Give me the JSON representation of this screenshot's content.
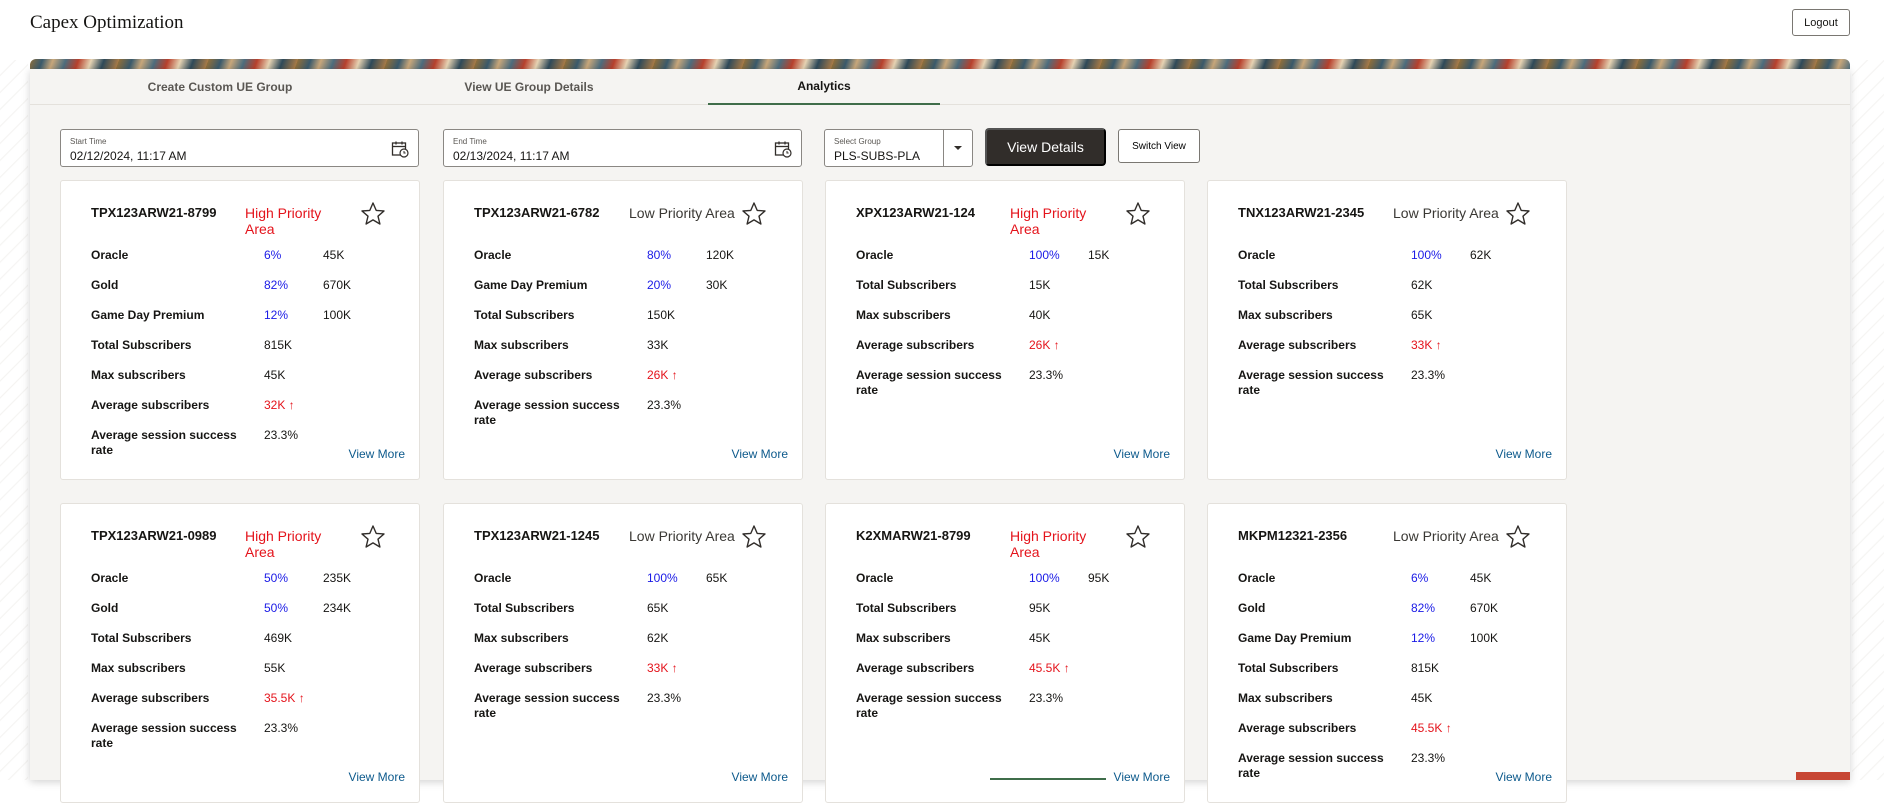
{
  "app": {
    "title": "Capex Optimization",
    "logout_label": "Logout"
  },
  "tabs": [
    {
      "label": "Create Custom UE Group"
    },
    {
      "label": "View UE Group Details"
    },
    {
      "label": "Analytics"
    }
  ],
  "filters": {
    "start_time": {
      "label": "Start Time",
      "value": "02/12/2024, 11:17 AM"
    },
    "end_time": {
      "label": "End Time",
      "value": "02/13/2024, 11:17 AM"
    },
    "group": {
      "label": "Select Group",
      "value": "PLS-SUBS-PLA"
    },
    "view_details_label": "View Details",
    "switch_view_label": "Switch View"
  },
  "colors": {
    "accent_dark": "#312d2a",
    "high_priority": "#e4131b",
    "percent": "#1a1ae6",
    "link": "#0d5a8c",
    "tab_underline": "#3f6d4a"
  },
  "cards": [
    {
      "id": "TPX123ARW21-8799",
      "priority": "High Priority Area",
      "level": "high",
      "rows": [
        {
          "label": "Oracle",
          "v1": "6%",
          "v2": "45K",
          "s1": "blue"
        },
        {
          "label": "Gold",
          "v1": "82%",
          "v2": "670K",
          "s1": "blue"
        },
        {
          "label": "Game Day Premium",
          "v1": "12%",
          "v2": "100K",
          "s1": "blue"
        },
        {
          "label": "Total Subscribers",
          "v1": "815K",
          "v2": ""
        },
        {
          "label": "Max subscribers",
          "v1": "45K",
          "v2": ""
        },
        {
          "label": "Average subscribers",
          "v1": "32K ↑",
          "v2": "",
          "s1": "red"
        },
        {
          "label": "Average session success rate",
          "v1": "23.3%",
          "v2": ""
        }
      ],
      "view_more": "View More"
    },
    {
      "id": "TPX123ARW21-6782",
      "priority": "Low Priority Area",
      "level": "low",
      "rows": [
        {
          "label": "Oracle",
          "v1": "80%",
          "v2": "120K",
          "s1": "blue"
        },
        {
          "label": "Game Day Premium",
          "v1": "20%",
          "v2": "30K",
          "s1": "blue"
        },
        {
          "label": "Total Subscribers",
          "v1": "150K",
          "v2": ""
        },
        {
          "label": "Max subscribers",
          "v1": "33K",
          "v2": ""
        },
        {
          "label": "Average subscribers",
          "v1": "26K ↑",
          "v2": "",
          "s1": "red"
        },
        {
          "label": "Average session success rate",
          "v1": "23.3%",
          "v2": ""
        }
      ],
      "view_more": "View More"
    },
    {
      "id": "XPX123ARW21-124",
      "priority": "High Priority Area",
      "level": "high",
      "rows": [
        {
          "label": "Oracle",
          "v1": "100%",
          "v2": "15K",
          "s1": "blue"
        },
        {
          "label": "Total Subscribers",
          "v1": "15K",
          "v2": ""
        },
        {
          "label": "Max subscribers",
          "v1": "40K",
          "v2": ""
        },
        {
          "label": "Average subscribers",
          "v1": "26K ↑",
          "v2": "",
          "s1": "red"
        },
        {
          "label": "Average session success rate",
          "v1": "23.3%",
          "v2": ""
        }
      ],
      "view_more": "View More"
    },
    {
      "id": "TNX123ARW21-2345",
      "priority": "Low Priority Area",
      "level": "low",
      "rows": [
        {
          "label": "Oracle",
          "v1": "100%",
          "v2": "62K",
          "s1": "blue"
        },
        {
          "label": "Total Subscribers",
          "v1": "62K",
          "v2": ""
        },
        {
          "label": "Max subscribers",
          "v1": "65K",
          "v2": ""
        },
        {
          "label": "Average subscribers",
          "v1": "33K ↑",
          "v2": "",
          "s1": "red"
        },
        {
          "label": "Average session success rate",
          "v1": "23.3%",
          "v2": ""
        }
      ],
      "view_more": "View More"
    },
    {
      "id": "TPX123ARW21-0989",
      "priority": "High Priority Area",
      "level": "high",
      "rows": [
        {
          "label": "Oracle",
          "v1": "50%",
          "v2": "235K",
          "s1": "blue"
        },
        {
          "label": "Gold",
          "v1": "50%",
          "v2": "234K",
          "s1": "blue"
        },
        {
          "label": "Total Subscribers",
          "v1": "469K",
          "v2": ""
        },
        {
          "label": "Max subscribers",
          "v1": "55K",
          "v2": ""
        },
        {
          "label": "Average subscribers",
          "v1": "35.5K ↑",
          "v2": "",
          "s1": "red"
        },
        {
          "label": "Average session success rate",
          "v1": "23.3%",
          "v2": ""
        }
      ],
      "view_more": "View More"
    },
    {
      "id": "TPX123ARW21-1245",
      "priority": "Low Priority Area",
      "level": "low",
      "rows": [
        {
          "label": "Oracle",
          "v1": "100%",
          "v2": "65K",
          "s1": "blue"
        },
        {
          "label": "Total Subscribers",
          "v1": "65K",
          "v2": ""
        },
        {
          "label": "Max subscribers",
          "v1": "62K",
          "v2": ""
        },
        {
          "label": "Average subscribers",
          "v1": "33K ↑",
          "v2": "",
          "s1": "red"
        },
        {
          "label": "Average session success rate",
          "v1": "23.3%",
          "v2": ""
        }
      ],
      "view_more": "View More"
    },
    {
      "id": "K2XMARW21-8799",
      "priority": "High Priority Area",
      "level": "high",
      "rows": [
        {
          "label": "Oracle",
          "v1": "100%",
          "v2": "95K",
          "s1": "blue"
        },
        {
          "label": "Total Subscribers",
          "v1": "95K",
          "v2": ""
        },
        {
          "label": "Max subscribers",
          "v1": "45K",
          "v2": ""
        },
        {
          "label": "Average subscribers",
          "v1": "45.5K ↑",
          "v2": "",
          "s1": "red"
        },
        {
          "label": "Average session success rate",
          "v1": "23.3%",
          "v2": ""
        }
      ],
      "view_more": "View More"
    },
    {
      "id": "MKPM12321-2356",
      "priority": "Low Priority Area",
      "level": "low",
      "rows": [
        {
          "label": "Oracle",
          "v1": "6%",
          "v2": "45K",
          "s1": "blue"
        },
        {
          "label": "Gold",
          "v1": "82%",
          "v2": "670K",
          "s1": "blue"
        },
        {
          "label": "Game Day Premium",
          "v1": "12%",
          "v2": "100K",
          "s1": "blue"
        },
        {
          "label": "Total Subscribers",
          "v1": "815K",
          "v2": ""
        },
        {
          "label": "Max subscribers",
          "v1": "45K",
          "v2": ""
        },
        {
          "label": "Average subscribers",
          "v1": "45.5K ↑",
          "v2": "",
          "s1": "red"
        },
        {
          "label": "Average session success rate",
          "v1": "23.3%",
          "v2": ""
        }
      ],
      "view_more": "View More"
    }
  ]
}
